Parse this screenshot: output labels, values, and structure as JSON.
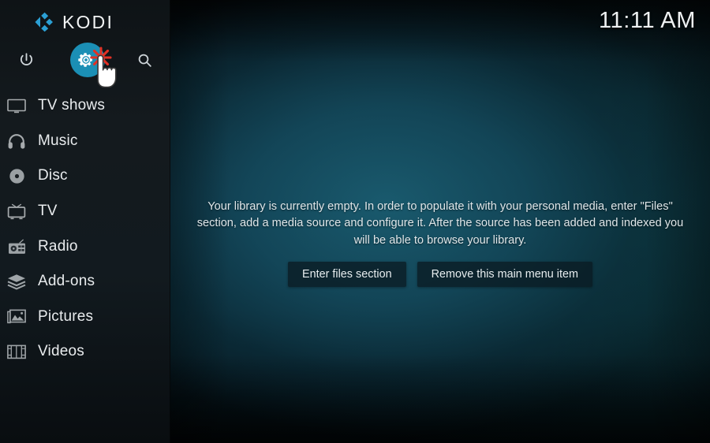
{
  "app": {
    "brand_name": "KODI",
    "logo_color": "#32a8d8",
    "accent_color": "#1b8fb5",
    "click_marker_color": "#e23125"
  },
  "header": {
    "clock": "11:11 AM"
  },
  "top_icons": [
    {
      "name": "power-icon",
      "label": "Power"
    },
    {
      "name": "settings-gear-icon",
      "label": "Settings",
      "highlighted": true
    },
    {
      "name": "search-icon",
      "label": "Search"
    }
  ],
  "sidebar": {
    "items": [
      {
        "label": "TV shows",
        "icon": "tv-monitor-icon"
      },
      {
        "label": "Music",
        "icon": "headphones-icon"
      },
      {
        "label": "Disc",
        "icon": "disc-icon"
      },
      {
        "label": "TV",
        "icon": "crt-tv-icon"
      },
      {
        "label": "Radio",
        "icon": "radio-icon"
      },
      {
        "label": "Add-ons",
        "icon": "package-box-icon"
      },
      {
        "label": "Pictures",
        "icon": "picture-frame-icon"
      },
      {
        "label": "Videos",
        "icon": "film-strip-icon"
      }
    ]
  },
  "main": {
    "empty_message": "Your library is currently empty. In order to populate it with your personal media, enter \"Files\" section, add a media source and configure it. After the source has been added and indexed you will be able to browse your library.",
    "buttons": [
      {
        "label": "Enter files section"
      },
      {
        "label": "Remove this main menu item"
      }
    ]
  }
}
